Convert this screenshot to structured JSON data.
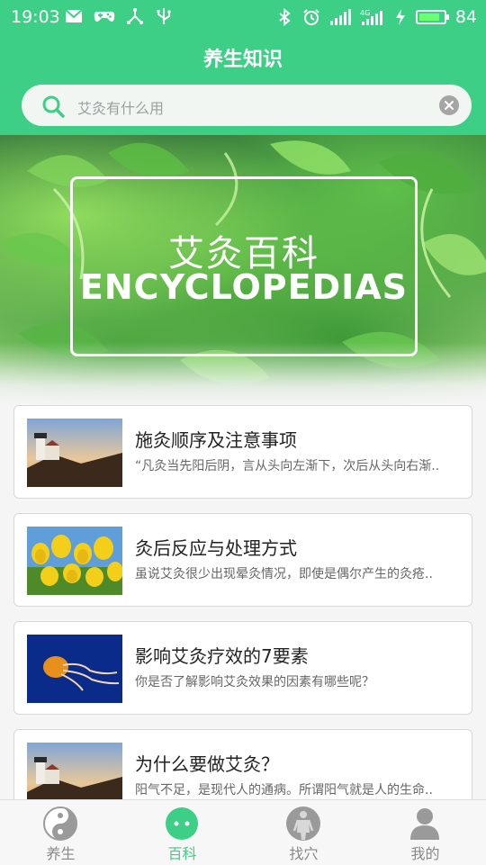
{
  "status_bar": {
    "time": "19:03",
    "battery_percent": "84",
    "battery_level": 0.84,
    "left_icons": [
      "mail-icon",
      "gamepad-icon",
      "share-icon",
      "usb-icon"
    ],
    "right_icons": [
      "bluetooth-icon",
      "alarm-icon",
      "signal-icon",
      "4g-signal-icon",
      "charging-icon",
      "battery-icon"
    ]
  },
  "header": {
    "title": "养生知识"
  },
  "search": {
    "placeholder": "艾灸有什么用"
  },
  "banner": {
    "title_cn": "艾灸百科",
    "title_en": "ENCYCLOPEDIAS"
  },
  "articles": [
    {
      "title": "施灸顺序及注意事项",
      "desc": "“凡灸当先阳后阴，言从头向左渐下，次后从头向右渐..",
      "thumb": "lighthouse-image"
    },
    {
      "title": "灸后反应与处理方式",
      "desc": "虽说艾灸很少出现晕灸情况，即使是偶尔产生的灸疮..",
      "thumb": "tulips-image"
    },
    {
      "title": "影响艾灸疗效的7要素",
      "desc": "你是否了解影响艾灸效果的因素有哪些呢？",
      "thumb": "jellyfish-image"
    },
    {
      "title": "为什么要做艾灸？",
      "desc": "阳气不足，是现代人的通病。所谓阳气就是人的生命..",
      "thumb": "lighthouse-image"
    }
  ],
  "nav": {
    "items": [
      {
        "label": "养生",
        "icon": "yin-yang-icon",
        "active": false
      },
      {
        "label": "百科",
        "icon": "chat-bubble-icon",
        "active": true
      },
      {
        "label": "找穴",
        "icon": "body-figure-icon",
        "active": false
      },
      {
        "label": "我的",
        "icon": "user-profile-icon",
        "active": false
      }
    ]
  },
  "colors": {
    "brand_green": "#3ecf86",
    "nav_inactive": "#888888"
  }
}
